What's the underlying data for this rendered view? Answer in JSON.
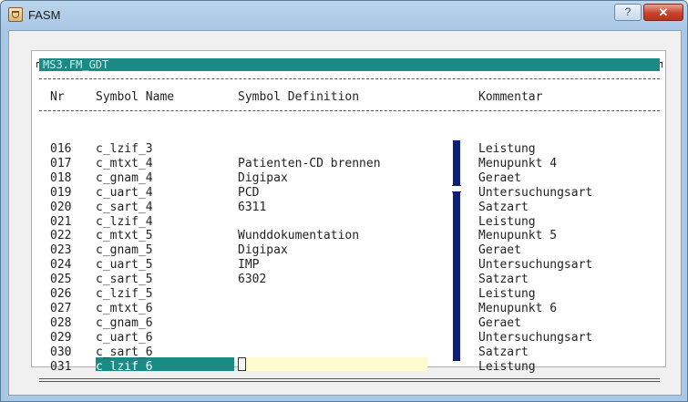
{
  "window": {
    "title": "FASM",
    "help_label": "?",
    "close_label": "✕"
  },
  "panel": {
    "title": "MS3.FM_GDT"
  },
  "table": {
    "headers": {
      "nr": "Nr",
      "symbol": "Symbol Name",
      "definition": "Symbol Definition",
      "comment": "Kommentar"
    },
    "rows": [
      {
        "nr": "016",
        "symbol": "c_lzif_3",
        "definition": "",
        "comment": "Leistung"
      },
      {
        "nr": "017",
        "symbol": "c_mtxt_4",
        "definition": "Patienten-CD brennen",
        "comment": "Menupunkt 4"
      },
      {
        "nr": "018",
        "symbol": "c_gnam_4",
        "definition": "Digipax",
        "comment": "Geraet"
      },
      {
        "nr": "019",
        "symbol": "c_uart_4",
        "definition": "PCD",
        "comment": "Untersuchungsart"
      },
      {
        "nr": "020",
        "symbol": "c_sart_4",
        "definition": "6311",
        "comment": "Satzart"
      },
      {
        "nr": "021",
        "symbol": "c_lzif_4",
        "definition": "",
        "comment": "Leistung"
      },
      {
        "nr": "022",
        "symbol": "c_mtxt_5",
        "definition": "Wunddokumentation",
        "comment": "Menupunkt 5"
      },
      {
        "nr": "023",
        "symbol": "c_gnam_5",
        "definition": "Digipax",
        "comment": "Geraet"
      },
      {
        "nr": "024",
        "symbol": "c_uart_5",
        "definition": "IMP",
        "comment": "Untersuchungsart"
      },
      {
        "nr": "025",
        "symbol": "c_sart_5",
        "definition": "6302",
        "comment": "Satzart"
      },
      {
        "nr": "026",
        "symbol": "c_lzif_5",
        "definition": "",
        "comment": "Leistung"
      },
      {
        "nr": "027",
        "symbol": "c_mtxt_6",
        "definition": "",
        "comment": "Menupunkt 6"
      },
      {
        "nr": "028",
        "symbol": "c_gnam_6",
        "definition": "",
        "comment": "Geraet"
      },
      {
        "nr": "029",
        "symbol": "c_uart_6",
        "definition": "",
        "comment": "Untersuchungsart"
      },
      {
        "nr": "030",
        "symbol": "c_sart_6",
        "definition": "",
        "comment": "Satzart"
      },
      {
        "nr": "031",
        "symbol": "c_lzif_6",
        "definition": "",
        "comment": "Leistung"
      }
    ],
    "selected_row": "031"
  },
  "colors": {
    "accent": "#1a8a84",
    "scrollbar": "#0e1f7a",
    "edit_field": "#fffbd0"
  }
}
